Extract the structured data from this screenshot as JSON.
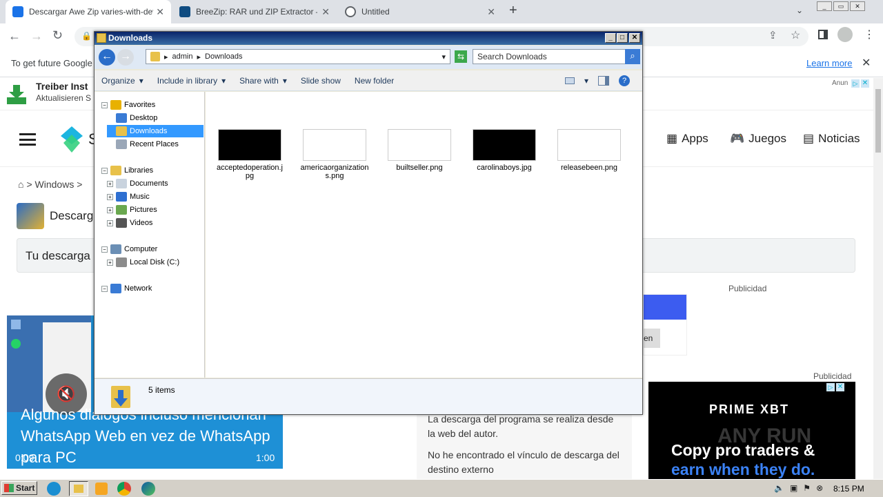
{
  "browser": {
    "tabs": [
      {
        "title": "Descargar Awe Zip varies-with-devic",
        "color": "#1a73e8"
      },
      {
        "title": "BreeZip: RAR und ZIP Extractor – Mi",
        "color": "#0f4c81"
      },
      {
        "title": "Untitled",
        "color": "#5f6368"
      }
    ],
    "new_tab": "+",
    "infobar_text": "To get future Google",
    "learn_more": "Learn more"
  },
  "page": {
    "ad_title": "Treiber Inst",
    "ad_subtitle": "Aktualisieren S",
    "ad_label": "Anun",
    "logo_letter": "S",
    "nav": [
      {
        "label": "Apps"
      },
      {
        "label": "Juegos"
      },
      {
        "label": "Noticias"
      }
    ],
    "breadcrumb": "> Windows >",
    "app_title": "Descarg",
    "download_box": "Tu descarga",
    "publicidad1": "Publicidad",
    "publicidad2": "Publicidad",
    "ad_button": "en",
    "body_text1": "La descarga del programa se realiza desde la web del autor.",
    "body_text2": "No he encontrado el vínculo de descarga del destino externo",
    "prime_brand": "PRIME XBT",
    "prime_line1": "Copy pro traders &",
    "prime_line2": "earn when they do.",
    "watermark": "ANY RUN"
  },
  "video": {
    "caption": "Algunos diálogos incluso mencionan WhatsApp Web en vez de WhatsApp para PC",
    "time_current": "0:09",
    "time_total": "1:00"
  },
  "explorer": {
    "title": "Downloads",
    "path": [
      "admin",
      "Downloads"
    ],
    "search_placeholder": "Search Downloads",
    "commands": [
      "Organize",
      "Include in library",
      "Share with",
      "Slide show",
      "New folder"
    ],
    "tree": [
      {
        "label": "Favorites",
        "level": 0,
        "icon": "star-icon",
        "color": "#e8b100"
      },
      {
        "label": "Desktop",
        "level": 1,
        "icon": "desktop-icon",
        "color": "#3a7bd5"
      },
      {
        "label": "Downloads",
        "level": 1,
        "icon": "downloads-folder-icon",
        "color": "#e8c14a",
        "selected": true
      },
      {
        "label": "Recent Places",
        "level": 1,
        "icon": "recent-places-icon",
        "color": "#9aa7b8"
      },
      {
        "label": "Libraries",
        "level": 0,
        "icon": "libraries-icon",
        "color": "#e8c14a"
      },
      {
        "label": "Documents",
        "level": 1,
        "icon": "documents-icon",
        "color": "#c9d3de"
      },
      {
        "label": "Music",
        "level": 1,
        "icon": "music-icon",
        "color": "#2e6fd1"
      },
      {
        "label": "Pictures",
        "level": 1,
        "icon": "pictures-icon",
        "color": "#6aa84f"
      },
      {
        "label": "Videos",
        "level": 1,
        "icon": "videos-icon",
        "color": "#555555"
      },
      {
        "label": "Computer",
        "level": 0,
        "icon": "computer-icon",
        "color": "#6b8fb5"
      },
      {
        "label": "Local Disk (C:)",
        "level": 1,
        "icon": "local-disk-icon",
        "color": "#8c8c8c"
      },
      {
        "label": "Network",
        "level": 0,
        "icon": "network-icon",
        "color": "#3a7bd5"
      }
    ],
    "files": [
      {
        "name": "acceptedoperation.jpg",
        "thumb": "#000000"
      },
      {
        "name": "americaorganizations.png",
        "thumb": "#ffffff"
      },
      {
        "name": "builtseller.png",
        "thumb": "#ffffff"
      },
      {
        "name": "carolinaboys.jpg",
        "thumb": "#000000"
      },
      {
        "name": "releasebeen.png",
        "thumb": "#ffffff"
      }
    ],
    "status": "5 items"
  },
  "taskbar": {
    "start": "Start",
    "clock": "8:15 PM"
  }
}
